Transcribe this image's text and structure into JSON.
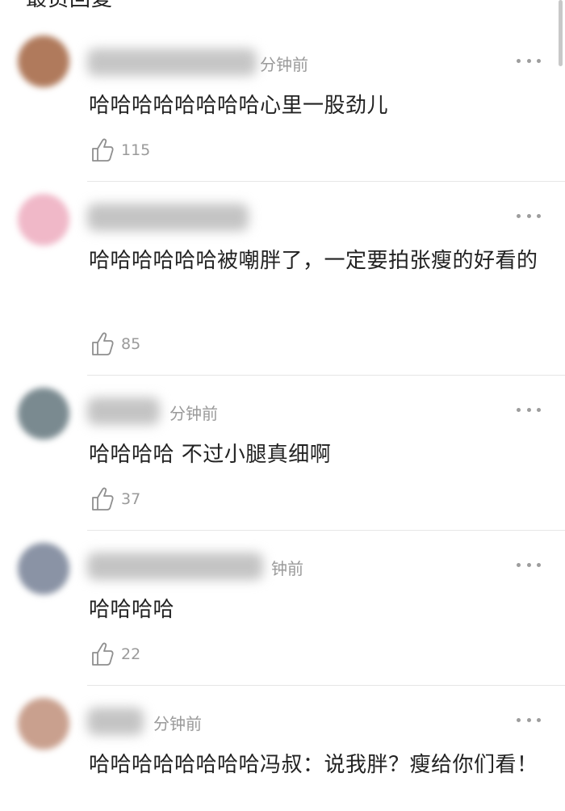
{
  "header": {
    "title": "最员回复"
  },
  "comments": [
    {
      "time": "分钟前",
      "text": "哈哈哈哈哈哈哈哈心里一股劲儿",
      "likes": "115",
      "avatar_color": "#b07a5c"
    },
    {
      "time": "",
      "text": "哈哈哈哈哈哈被嘲胖了，一定要拍张瘦的好看的",
      "likes": "85",
      "avatar_color": "#f0b8c8"
    },
    {
      "time": "分钟前",
      "text": "哈哈哈哈 不过小腿真细啊",
      "likes": "37",
      "avatar_color": "#7a8a90"
    },
    {
      "time": "钟前",
      "text": "哈哈哈哈",
      "likes": "22",
      "avatar_color": "#8a93a5"
    },
    {
      "time": "分钟前",
      "text": "哈哈哈哈哈哈哈哈冯叔：说我胖？瘦给你们看！",
      "likes": "",
      "avatar_color": "#c9a08e"
    }
  ],
  "icons": {
    "like": "thumbs-up-icon",
    "more": "more-dots-icon"
  }
}
